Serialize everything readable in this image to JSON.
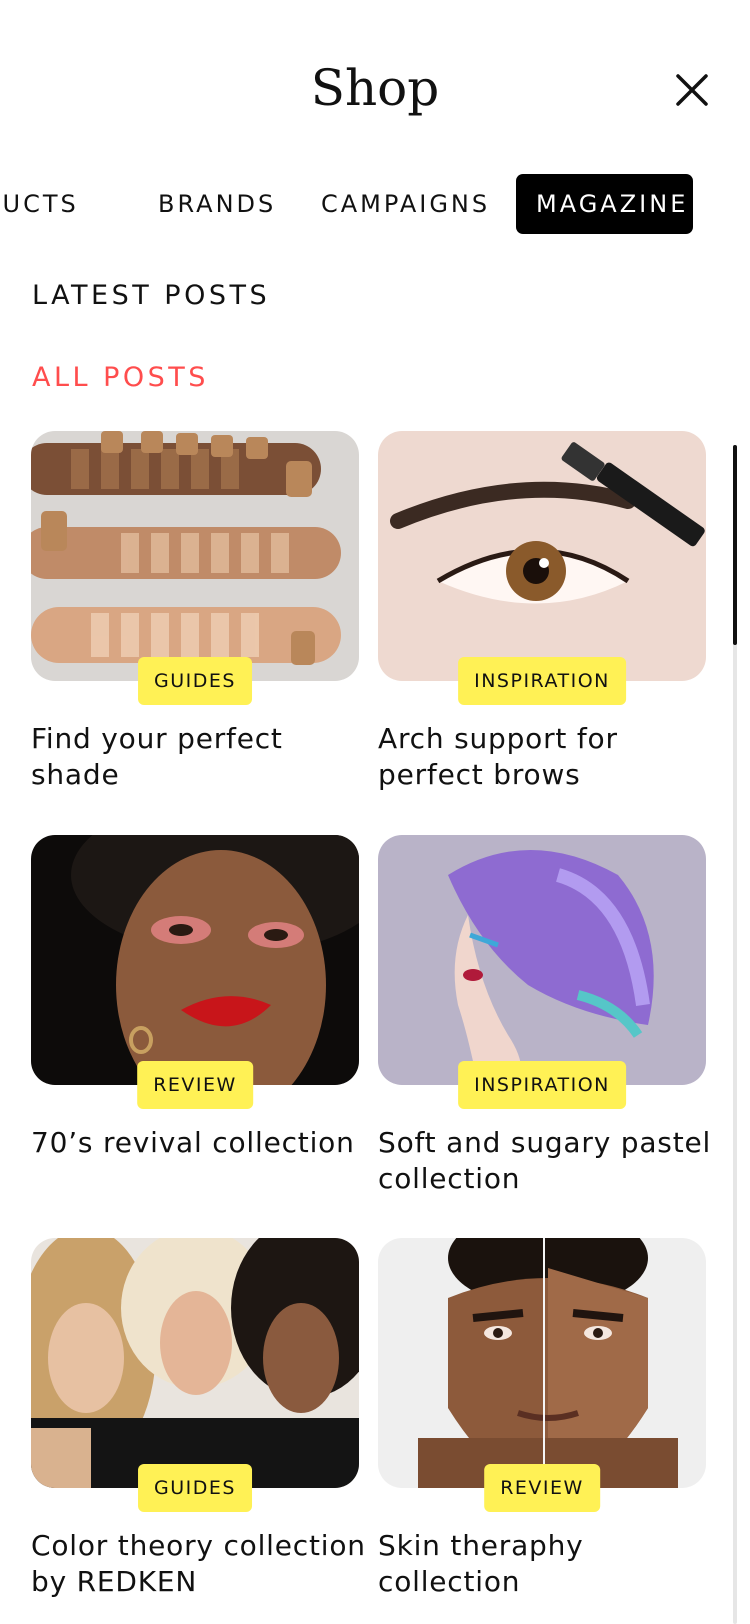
{
  "header": {
    "title": "Shop",
    "close_icon": "close-icon"
  },
  "tabs": [
    {
      "label": "PRODUCTS",
      "active": false
    },
    {
      "label": "BRANDS",
      "active": false
    },
    {
      "label": "CAMPAIGNS",
      "active": false
    },
    {
      "label": "MAGAZINE",
      "active": true
    }
  ],
  "section": {
    "title": "LATEST POSTS",
    "filter_label": "ALL POSTS"
  },
  "posts": [
    {
      "tag": "GUIDES",
      "title": "Find your perfect shade"
    },
    {
      "tag": "INSPIRATION",
      "title": "Arch support for perfect brows"
    },
    {
      "tag": "REVIEW",
      "title": "70’s revival collection"
    },
    {
      "tag": "INSPIRATION",
      "title": "Soft and sugary pastel collection"
    },
    {
      "tag": "GUIDES",
      "title": "Color theory collection by REDKEN"
    },
    {
      "tag": "REVIEW",
      "title": "Skin theraphy collection"
    }
  ],
  "colors": {
    "accent": "#ff4d4d",
    "badge": "#fff155",
    "active_tab": "#000000"
  }
}
